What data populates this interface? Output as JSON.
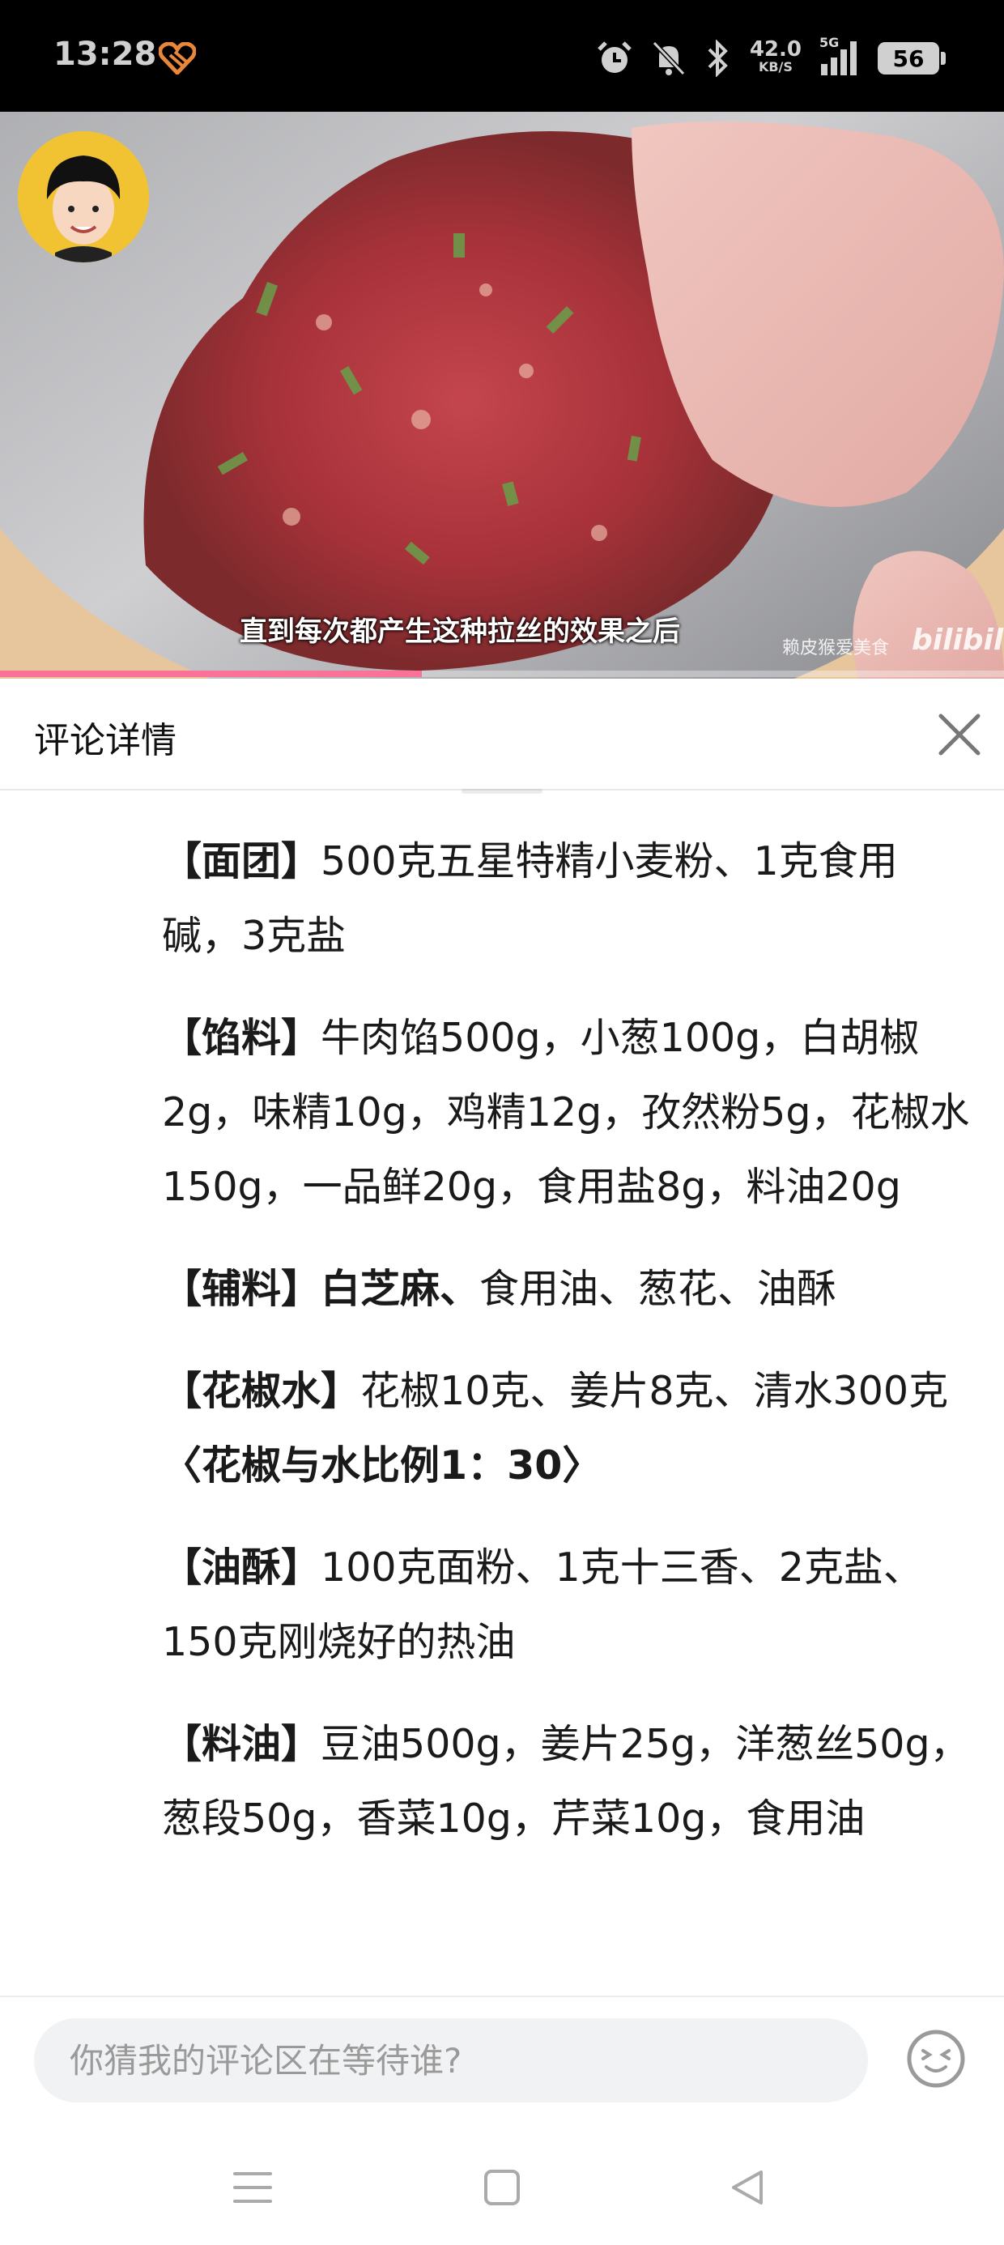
{
  "status_bar": {
    "time": "13:28",
    "net_speed": "42.0",
    "net_speed_unit": "KB/S",
    "network": "5G",
    "battery": "56"
  },
  "video": {
    "subtitle": "直到每次都产生这种拉丝的效果之后",
    "uploader_watermark": "赖皮猴爱美食",
    "site_watermark": "bilibili",
    "progress_percent": 42
  },
  "comment_panel": {
    "title": "评论详情",
    "paragraphs": [
      {
        "head": "【面团】",
        "text": "500克五星特精小麦粉、1克食用碱，3克盐"
      },
      {
        "head": "【馅料】",
        "text": "牛肉馅500g，小葱100g，白胡椒2g，味精10g，鸡精12g，孜然粉5g，花椒水150g，一品鲜20g，食用盐8g，料油20g"
      },
      {
        "head": "【辅料】",
        "bold_tail": "白芝麻、",
        "text": "食用油、葱花、油酥"
      },
      {
        "head": "【花椒水】",
        "text": "花椒10克、姜片8克、清水300克",
        "bold_tail": "〈花椒与水比例1：30〉"
      },
      {
        "head": "【油酥】",
        "text": "100克面粉、1克十三香、2克盐、150克刚烧好的热油"
      },
      {
        "head": "【料油】",
        "text": "豆油500g，姜片25g，洋葱丝50g，葱段50g，香菜10g，芹菜10g，食用油"
      }
    ]
  },
  "input_bar": {
    "placeholder": "你猜我的评论区在等待谁?"
  },
  "icons": {
    "close": "close-icon",
    "emoji": "emoji-icon",
    "menu": "menu-icon",
    "home": "home-icon",
    "back": "back-icon"
  },
  "colors": {
    "accent": "#fb7299",
    "status_bg": "#000000"
  }
}
